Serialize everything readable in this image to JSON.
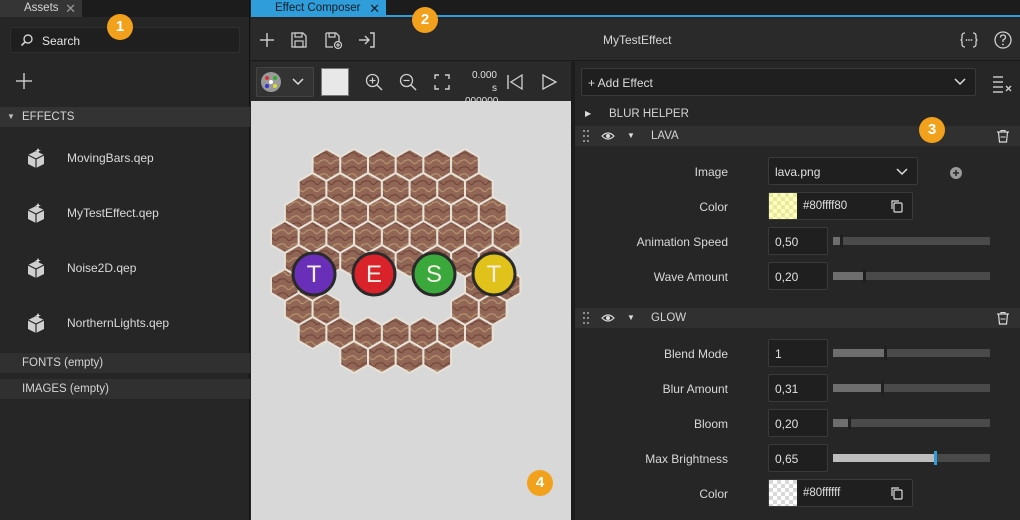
{
  "assets": {
    "tab_label": "Assets",
    "search_placeholder": "Search",
    "sections": {
      "effects": "EFFECTS",
      "fonts": "FONTS (empty)",
      "images": "IMAGES (empty)"
    },
    "items": [
      {
        "name": "MovingBars.qep"
      },
      {
        "name": "MyTestEffect.qep"
      },
      {
        "name": "Noise2D.qep"
      },
      {
        "name": "NorthernLights.qep"
      }
    ]
  },
  "composer": {
    "tab_label": "Effect Composer",
    "title": "MyTestEffect",
    "time_seconds": "0.000 s",
    "time_frames": "000000",
    "add_effect_label": "+ Add Effect",
    "preview_text": [
      "T",
      "E",
      "S",
      "T"
    ],
    "groups": {
      "blur_helper": {
        "name": "BLUR HELPER"
      },
      "lava": {
        "name": "LAVA",
        "image_label": "Image",
        "image_value": "lava.png",
        "color_label": "Color",
        "color_value": "#80ffff80",
        "animation_speed_label": "Animation Speed",
        "animation_speed_value": "0,50",
        "animation_speed_level": 0.05,
        "wave_amount_label": "Wave Amount",
        "wave_amount_value": "0,20",
        "wave_amount_level": 0.2
      },
      "glow": {
        "name": "GLOW",
        "blend_mode_label": "Blend Mode",
        "blend_mode_value": "1",
        "blend_mode_level": 0.33,
        "blur_amount_label": "Blur Amount",
        "blur_amount_value": "0,31",
        "blur_amount_level": 0.31,
        "bloom_label": "Bloom",
        "bloom_value": "0,20",
        "bloom_level": 0.1,
        "max_brightness_label": "Max Brightness",
        "max_brightness_value": "0,65",
        "max_brightness_level": 0.65,
        "color_label": "Color",
        "color_value": "#80ffffff"
      }
    }
  },
  "callouts": [
    "1",
    "2",
    "3",
    "4"
  ],
  "colors": {
    "accent": "#2f9dd9",
    "callout": "#f2a11c",
    "ball_t1": "#6a2fb8",
    "ball_e": "#d9222a",
    "ball_s": "#3aa83a",
    "ball_t2": "#e0c21a"
  }
}
